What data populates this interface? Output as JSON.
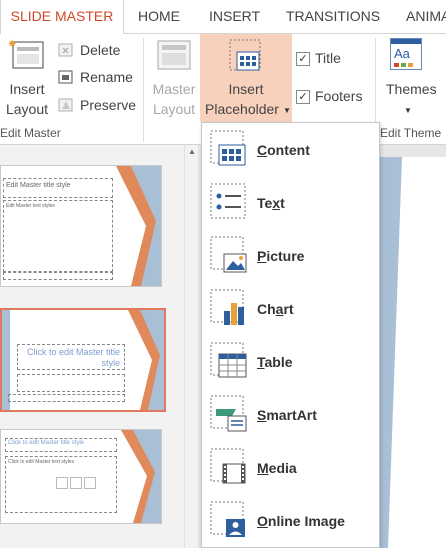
{
  "tabs": [
    {
      "label": "SLIDE MASTER",
      "active": true
    },
    {
      "label": "HOME"
    },
    {
      "label": "INSERT"
    },
    {
      "label": "TRANSITIONS"
    },
    {
      "label": "ANIMA"
    }
  ],
  "ribbon": {
    "edit_master": {
      "insert_layout_line1": "Insert",
      "insert_layout_line2": "Layout",
      "delete": "Delete",
      "rename": "Rename",
      "preserve": "Preserve",
      "group_label": "Edit Master"
    },
    "master_layout": {
      "master_layout_line1": "Master",
      "master_layout_line2": "Layout",
      "insert_placeholder_line1": "Insert",
      "insert_placeholder_line2": "Placeholder",
      "title_check": "Title",
      "footers_check": "Footers"
    },
    "edit_theme": {
      "themes": "Themes",
      "group_label": "Edit Theme",
      "theme_icon_text": "Aa"
    }
  },
  "thumbnails": [
    {
      "title": "Edit Master title style",
      "body": "Edit Master text styles"
    },
    {
      "title": "Click to edit Master title style",
      "selected": true
    },
    {
      "title": "Click to edit Master title style",
      "body": "Click to edit Master text styles"
    }
  ],
  "placeholder_menu": {
    "items": [
      {
        "label": "Content",
        "underline": "C",
        "rest": "ontent",
        "icon": "content-icon"
      },
      {
        "label": "Text",
        "underline": "x",
        "pre": "Te",
        "rest": "t",
        "icon": "text-icon"
      },
      {
        "label": "Picture",
        "underline": "P",
        "rest": "icture",
        "icon": "picture-icon"
      },
      {
        "label": "Chart",
        "underline": "a",
        "pre": "Ch",
        "rest": "rt",
        "icon": "chart-icon"
      },
      {
        "label": "Table",
        "underline": "T",
        "rest": "able",
        "icon": "table-icon"
      },
      {
        "label": "SmartArt",
        "underline": "S",
        "rest": "martArt",
        "icon": "smartart-icon"
      },
      {
        "label": "Media",
        "underline": "M",
        "rest": "edia",
        "icon": "media-icon"
      },
      {
        "label": "Online Image",
        "underline": "O",
        "rest": "nline Image",
        "icon": "online-image-icon"
      }
    ]
  },
  "colors": {
    "accent": "#d24726",
    "highlight": "#f8d1bd",
    "slide_orange": "#e08a5c",
    "slide_blue": "#a9bfd6"
  }
}
